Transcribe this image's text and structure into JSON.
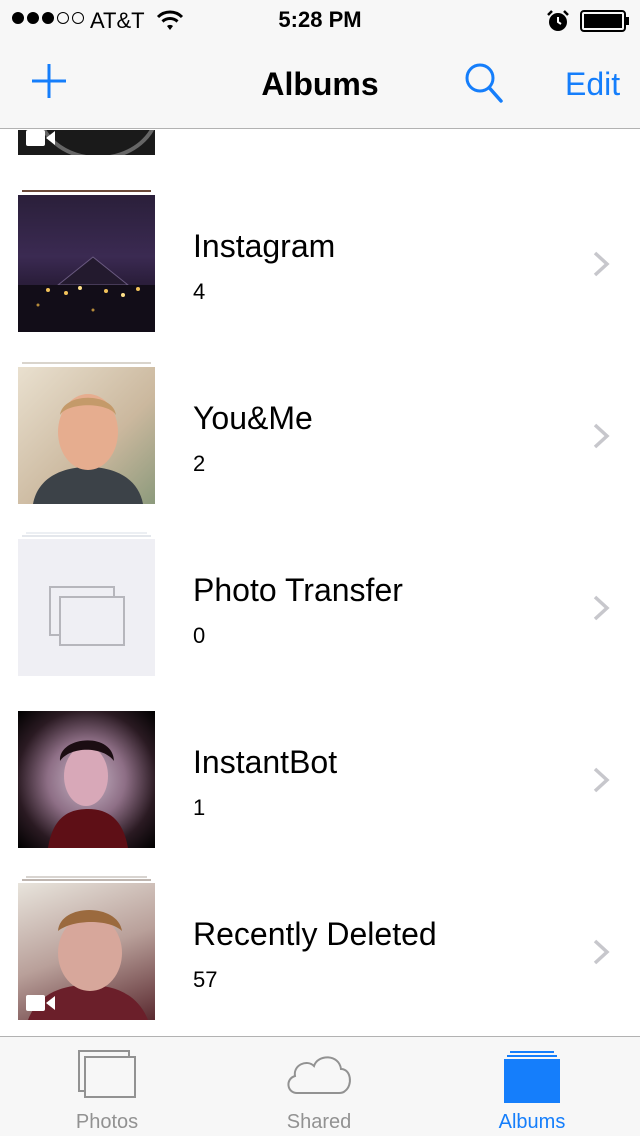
{
  "status_bar": {
    "carrier": "AT&T",
    "time": "5:28 PM",
    "signal_bars_filled": 3,
    "signal_bars_total": 5
  },
  "nav": {
    "title": "Albums",
    "edit_label": "Edit",
    "add_icon": "plus-icon",
    "search_icon": "search-icon"
  },
  "albums": [
    {
      "name": "Instagram",
      "count": "4"
    },
    {
      "name": "You&Me",
      "count": "2"
    },
    {
      "name": "Photo Transfer",
      "count": "0"
    },
    {
      "name": "InstantBot",
      "count": "1"
    },
    {
      "name": "Recently Deleted",
      "count": "57"
    }
  ],
  "tabs": [
    {
      "label": "Photos",
      "icon": "photos-icon",
      "active": false
    },
    {
      "label": "Shared",
      "icon": "cloud-icon",
      "active": false
    },
    {
      "label": "Albums",
      "icon": "albums-icon",
      "active": true
    }
  ],
  "colors": {
    "accent": "#157efb",
    "inactive_tab": "#929292",
    "bar_background": "#f7f7f7",
    "separator": "#b2b2b2"
  }
}
